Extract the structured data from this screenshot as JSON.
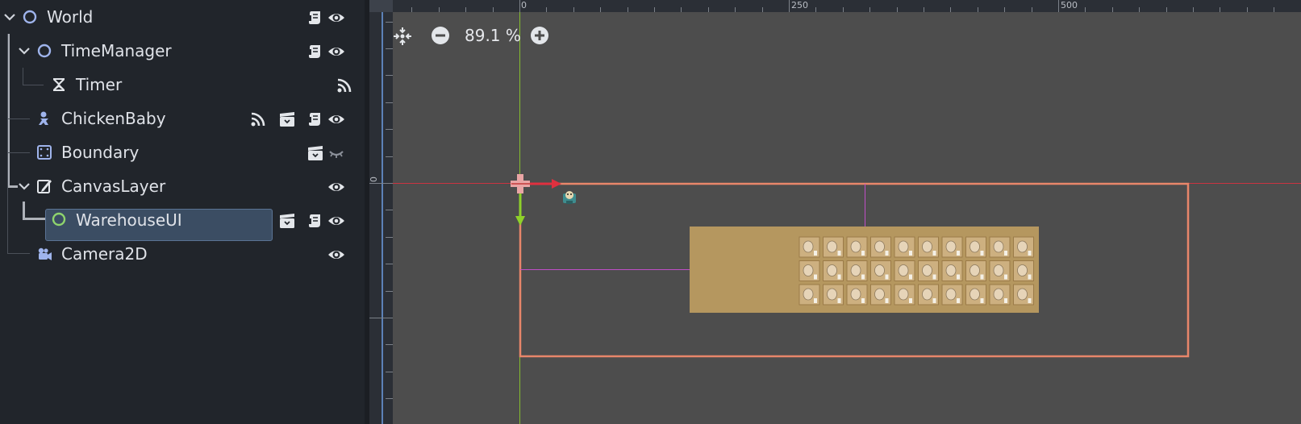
{
  "scene_tree": {
    "nodes": [
      {
        "name": "World"
      },
      {
        "name": "TimeManager"
      },
      {
        "name": "Timer"
      },
      {
        "name": "ChickenBaby"
      },
      {
        "name": "Boundary"
      },
      {
        "name": "CanvasLayer"
      },
      {
        "name": "WarehouseUI",
        "selected": true
      },
      {
        "name": "Camera2D"
      }
    ]
  },
  "viewport": {
    "zoom_label": "89.1 %",
    "ruler_labels": [
      "0",
      "250",
      "500"
    ],
    "ruler_left_labels": [
      "0"
    ],
    "colors": {
      "x_axis": "#e0303f",
      "y_axis": "#8fd12a",
      "boundary": "#e8866a",
      "ui_panel": "#b5975f",
      "slot": "#cdb080",
      "guide": "#c04ec7"
    }
  }
}
